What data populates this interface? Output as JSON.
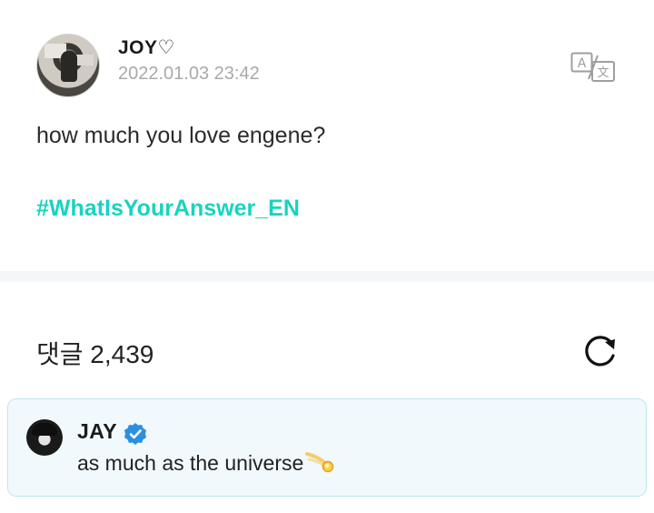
{
  "post": {
    "author": "JOY♡",
    "timestamp": "2022.01.03 23:42",
    "text": "how much you love engene?",
    "hashtag": "#WhatIsYourAnswer_EN",
    "translate_icon": "translate-icon"
  },
  "comments": {
    "label": "댓글 2,439",
    "refresh_icon": "refresh-icon",
    "items": [
      {
        "author": "JAY",
        "verified": true,
        "text": "as much as the universe",
        "emoji_icon": "comet-icon"
      }
    ]
  },
  "colors": {
    "hashtag": "#17d4bf",
    "comment_bg": "#f1f9fd",
    "comment_border": "#bde6ef",
    "verified": "#2b8fe0",
    "divider": "#f4f6f8"
  }
}
